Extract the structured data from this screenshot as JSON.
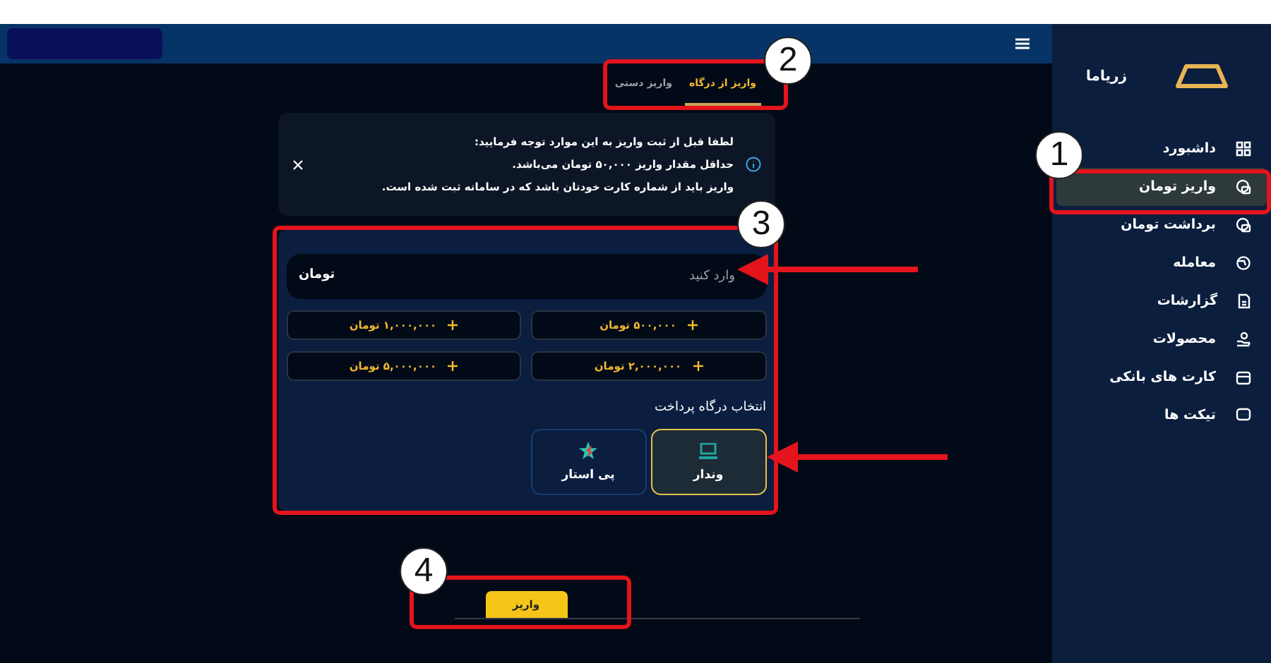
{
  "sidebar": {
    "brand": "زریاما",
    "items": [
      {
        "label": "داشبورد",
        "selected": false
      },
      {
        "label": "واریز تومان",
        "selected": true
      },
      {
        "label": "برداشت تومان",
        "selected": false
      },
      {
        "label": "معامله",
        "selected": false
      },
      {
        "label": "گزارشات",
        "selected": false
      },
      {
        "label": "محصولات",
        "selected": false
      },
      {
        "label": "کارت های بانکی",
        "selected": false
      },
      {
        "label": "تیکت ها",
        "selected": false
      }
    ]
  },
  "tabs": [
    {
      "label": "واریز از درگاه",
      "selected": true
    },
    {
      "label": "واریز دستی",
      "selected": false
    }
  ],
  "notice": {
    "lines": [
      "لطفا قبل از ثبت واریز به این موارد توجه فرمایید:",
      "حداقل مقدار واریز ۵۰,۰۰۰ تومان می‌باشد.",
      "واریز باید از شماره کارت خودتان باشد که در سامانه ثبت شده است."
    ]
  },
  "amount_field": {
    "placeholder": "وارد کنید",
    "unit": "تومان"
  },
  "quick_amounts": [
    "۵۰۰,۰۰۰ تومان",
    "۱,۰۰۰,۰۰۰ تومان",
    "۲,۰۰۰,۰۰۰ تومان",
    "۵,۰۰۰,۰۰۰ تومان"
  ],
  "gateway_title": "انتخاب درگاه پرداخت",
  "gateways": [
    {
      "label": "وندار",
      "selected": true,
      "kind": "laptop"
    },
    {
      "label": "پی استار",
      "selected": false,
      "kind": "star"
    }
  ],
  "submit": "واریز",
  "annotations": {
    "badges": [
      "1",
      "2",
      "3",
      "4"
    ]
  }
}
